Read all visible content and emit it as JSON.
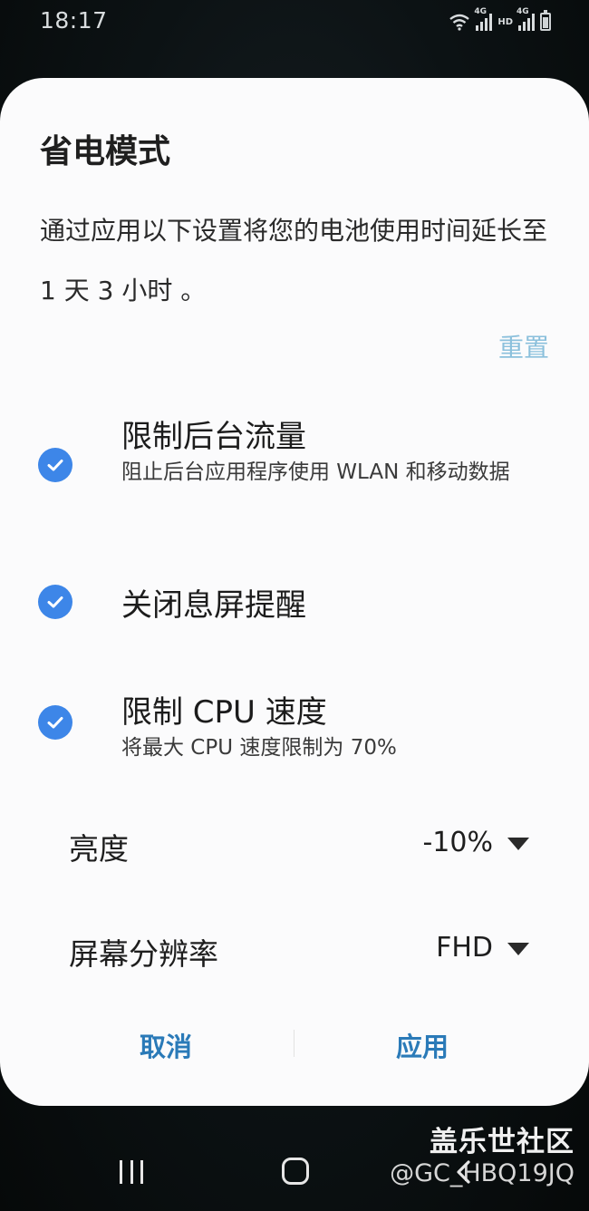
{
  "status_bar": {
    "time": "18:17",
    "icons": [
      "wifi-icon",
      "signal-4g-icon",
      "hd-icon",
      "signal-4g-icon",
      "battery-icon"
    ],
    "network_label_1": "4G",
    "hd_label": "HD",
    "network_label_2": "4G"
  },
  "dialog": {
    "title": "省电模式",
    "description": "通过应用以下设置将您的电池使用时间延长至 1 天 3 小时 。",
    "reset_label": "重置",
    "options": [
      {
        "checked": true,
        "title": "限制后台流量",
        "subtitle": "阻止后台应用程序使用 WLAN 和移动数据"
      },
      {
        "checked": true,
        "title": "关闭息屏提醒",
        "subtitle": ""
      },
      {
        "checked": true,
        "title": "限制 CPU 速度",
        "subtitle": "将最大 CPU 速度限制为 70%"
      }
    ],
    "settings": [
      {
        "label": "亮度",
        "value": "-10%"
      },
      {
        "label": "屏幕分辨率",
        "value": "FHD"
      }
    ],
    "cancel_label": "取消",
    "apply_label": "应用"
  },
  "colors": {
    "accent": "#2a7ab8",
    "check": "#3d86e8",
    "reset": "#8bc0dc"
  },
  "watermark": {
    "brand": "盖乐世社区",
    "user": "@GC_HBQ19JQ"
  }
}
